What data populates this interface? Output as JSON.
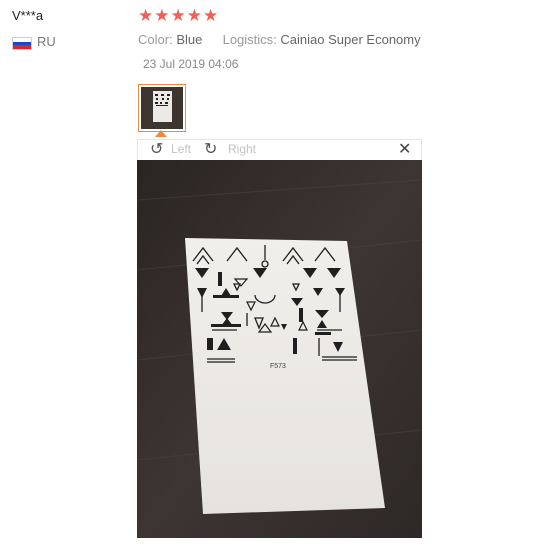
{
  "review": {
    "user": "V***a",
    "country": "RU",
    "rating": 5,
    "stars": [
      "★",
      "★",
      "★",
      "★",
      "★"
    ],
    "color_label": "Color:",
    "color_value": "Blue",
    "logistics_label": "Logistics:",
    "logistics_value": "Cainiao Super Economy",
    "date": "23 Jul 2019 04:06"
  },
  "viewer": {
    "left_label": "Left",
    "right_label": "Right",
    "left_icon": "rotate-left-icon",
    "right_icon": "rotate-right-icon",
    "close_icon": "close-icon",
    "sheet_code": "F573"
  },
  "colors": {
    "star": "#f46056",
    "thumb_border": "#f0883e",
    "flag_white": "#ffffff",
    "flag_blue": "#1c46c8",
    "flag_red": "#d8262c"
  }
}
